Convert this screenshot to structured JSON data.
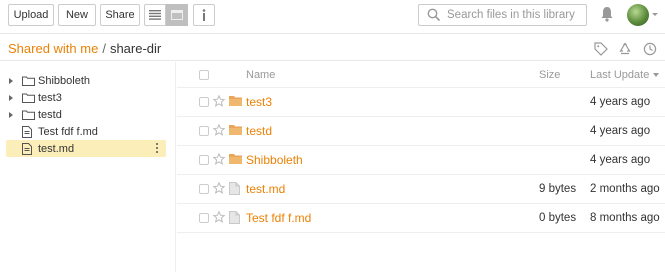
{
  "toolbar": {
    "upload_label": "Upload",
    "new_label": "New",
    "share_label": "Share",
    "view_icons": [
      "list-view-icon",
      "grid-view-icon",
      "info-icon"
    ],
    "search_placeholder": "Search files in this library"
  },
  "path": {
    "parent": "Shared with me",
    "separator": "/",
    "current": "share-dir"
  },
  "path_icons": [
    "tag-icon",
    "recycle-icon",
    "history-icon"
  ],
  "sidebar": {
    "items": [
      {
        "label": "Shibboleth",
        "type": "folder"
      },
      {
        "label": "test3",
        "type": "folder"
      },
      {
        "label": "testd",
        "type": "folder"
      },
      {
        "label": "Test fdf f.md",
        "type": "file"
      },
      {
        "label": "test.md",
        "type": "file",
        "selected": true
      }
    ]
  },
  "table": {
    "headers": {
      "name": "Name",
      "size": "Size",
      "last_update": "Last Update"
    },
    "rows": [
      {
        "name": "test3",
        "type": "folder",
        "size": "",
        "updated": "4 years ago"
      },
      {
        "name": "testd",
        "type": "folder",
        "size": "",
        "updated": "4 years ago"
      },
      {
        "name": "Shibboleth",
        "type": "folder",
        "size": "",
        "updated": "4 years ago"
      },
      {
        "name": "test.md",
        "type": "file",
        "size": "9 bytes",
        "updated": "2 months ago"
      },
      {
        "name": "Test fdf f.md",
        "type": "file",
        "size": "0 bytes",
        "updated": "8 months ago"
      }
    ]
  },
  "colors": {
    "accent": "#eb8205",
    "selected_bg": "#fbeeb9"
  }
}
